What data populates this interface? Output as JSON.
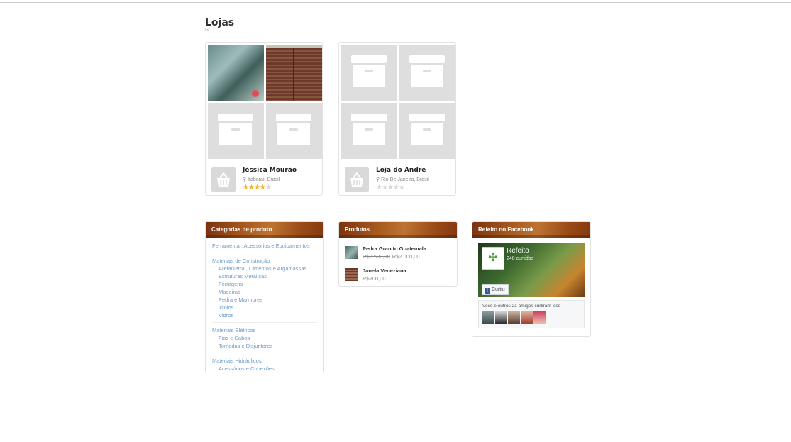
{
  "section": {
    "title": "Lojas"
  },
  "stores": [
    {
      "name": "Jéssica Mourão",
      "location": "Itaboraí, Brasil",
      "rating": 4,
      "rating_max": 5
    },
    {
      "name": "Loja do Andre",
      "location": "Rio De Janeiro, Brasil",
      "rating": 0,
      "rating_max": 5
    }
  ],
  "categories": {
    "title": "Categorias de produto",
    "groups": [
      {
        "label": "Ferramenta , Acessórios e Equipamentos",
        "children": []
      },
      {
        "label": "Materiais de Construção",
        "children": [
          "Areia/Terra , Cimentos e Argamassas",
          "Estruturas Metálicas",
          "Ferragens",
          "Madeiras",
          "Pedra e Marmores",
          "Tijolos",
          "Vidros"
        ]
      },
      {
        "label": "Materiais Elétricos",
        "children": [
          "Fios e Cabos",
          "Tomadas e Disjuntores"
        ]
      },
      {
        "label": "Materiais Hidráulicos",
        "children": [
          "Acessórios e Conexões"
        ]
      }
    ]
  },
  "products": {
    "title": "Produtos",
    "items": [
      {
        "name": "Pedra Granito Guatemala",
        "old_price": "R$3.500,00",
        "price": "R$2.000,00"
      },
      {
        "name": "Janela Veneziana",
        "old_price": "",
        "price": "R$200,00"
      }
    ]
  },
  "facebook": {
    "title": "Refeito no Facebook",
    "page_name": "Refeito",
    "likes": "248 curtidas",
    "like_button": "Curtiu",
    "friends_text": "Você e outros 21 amigos curtiram isso"
  },
  "colors": {
    "header_brown": "#9a4b17",
    "link_blue": "#6f9cc7",
    "star_gold": "#f2b01e"
  }
}
